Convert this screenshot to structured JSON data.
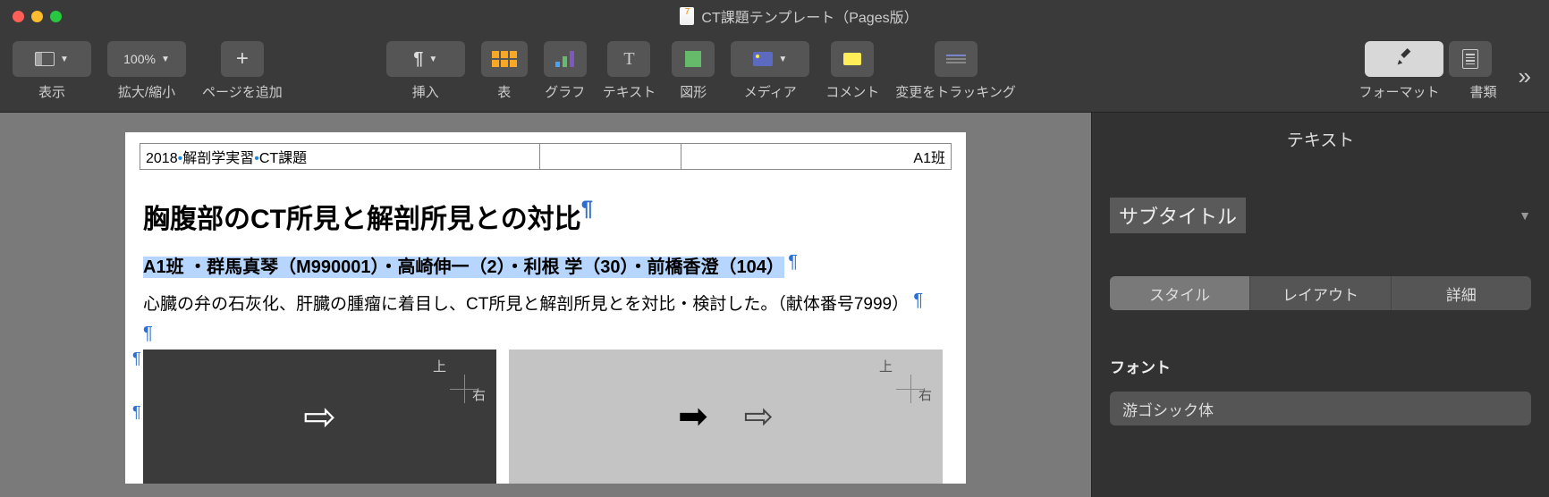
{
  "window": {
    "title": "CT課題テンプレート（Pages版）"
  },
  "toolbar": {
    "view": "表示",
    "zoom_value": "100%",
    "zoom_label": "拡大/縮小",
    "add_page": "ページを追加",
    "insert": "挿入",
    "table": "表",
    "chart": "グラフ",
    "text": "テキスト",
    "shape": "図形",
    "media": "メディア",
    "comment": "コメント",
    "tracking": "変更をトラッキング",
    "format": "フォーマット",
    "document": "書類"
  },
  "doc": {
    "header_left_year": "2018",
    "header_left_course": "解剖学実習",
    "header_left_task": "CT課題",
    "header_right": "A1班",
    "title": "胸腹部のCT所見と解剖所見との対比",
    "authors": "A1班 ・群馬真琴（M990001）・高崎伸一（2）・利根 学（30）・前橋香澄（104）",
    "body": "心臓の弁の石灰化、肝臓の腫瘤に着目し、CT所見と解剖所見とを対比・検討した。（献体番号7999）",
    "orient_up": "上",
    "orient_right": "右"
  },
  "inspector": {
    "panel_title": "テキスト",
    "style_name": "サブタイトル",
    "tabs": {
      "style": "スタイル",
      "layout": "レイアウト",
      "detail": "詳細"
    },
    "font_label": "フォント",
    "font_value": "游ゴシック体"
  }
}
